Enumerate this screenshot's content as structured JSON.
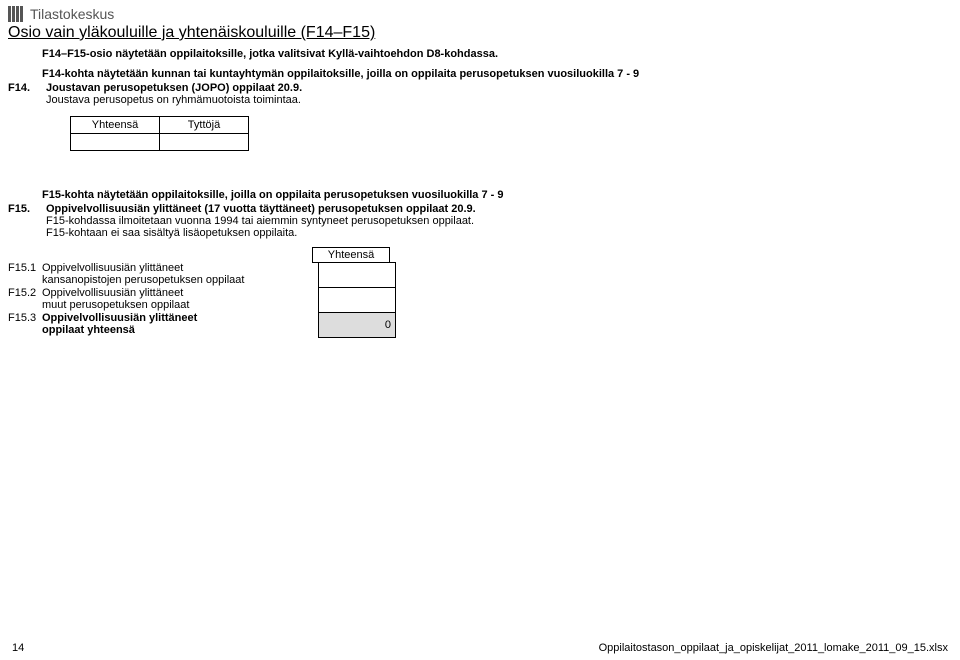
{
  "header": {
    "org_name": "Tilastokeskus",
    "section_title": "Osio vain yläkouluille ja yhtenäiskouluille (F14–F15)"
  },
  "intro": "F14–F15-osio näytetään oppilaitoksille, jotka valitsivat Kyllä-vaihtoehdon D8-kohdassa.",
  "f14": {
    "note": "F14-kohta näytetään kunnan tai kuntayhtymän oppilaitoksille, joilla on oppilaita perusopetuksen vuosiluokilla 7 - 9",
    "code": "F14.",
    "title": "Joustavan perusopetuksen (JOPO) oppilaat 20.9.",
    "subnote": "Joustava perusopetus on ryhmämuotoista toimintaa.",
    "table": {
      "col1": "Yhteensä",
      "col2": "Tyttöjä",
      "v1": "",
      "v2": ""
    }
  },
  "f15": {
    "note": "F15-kohta näytetään oppilaitoksille, joilla on oppilaita perusopetuksen vuosiluokilla 7 - 9",
    "code": "F15.",
    "title": "Oppivelvollisuusiän ylittäneet (17 vuotta täyttäneet) perusopetuksen oppilaat 20.9.",
    "sub1": "F15-kohdassa ilmoitetaan vuonna 1994 tai aiemmin syntyneet perusopetuksen oppilaat.",
    "sub2": "F15-kohtaan ei saa sisältyä lisäopetuksen oppilaita.",
    "header": "Yhteensä",
    "rows": [
      {
        "code": "F15.1",
        "label_l1": "Oppivelvollisuusiän ylittäneet",
        "label_l2": "kansanopistojen perusopetuksen oppilaat",
        "value": "",
        "shaded": false
      },
      {
        "code": "F15.2",
        "label_l1": "Oppivelvollisuusiän ylittäneet",
        "label_l2": "muut perusopetuksen oppilaat",
        "value": "",
        "shaded": false
      },
      {
        "code": "F15.3",
        "label_l1": "Oppivelvollisuusiän ylittäneet",
        "label_l2": "oppilaat yhteensä",
        "value": "0",
        "shaded": true
      }
    ]
  },
  "footer": {
    "page": "14",
    "file": "Oppilaitostason_oppilaat_ja_opiskelijat_2011_lomake_2011_09_15.xlsx"
  }
}
